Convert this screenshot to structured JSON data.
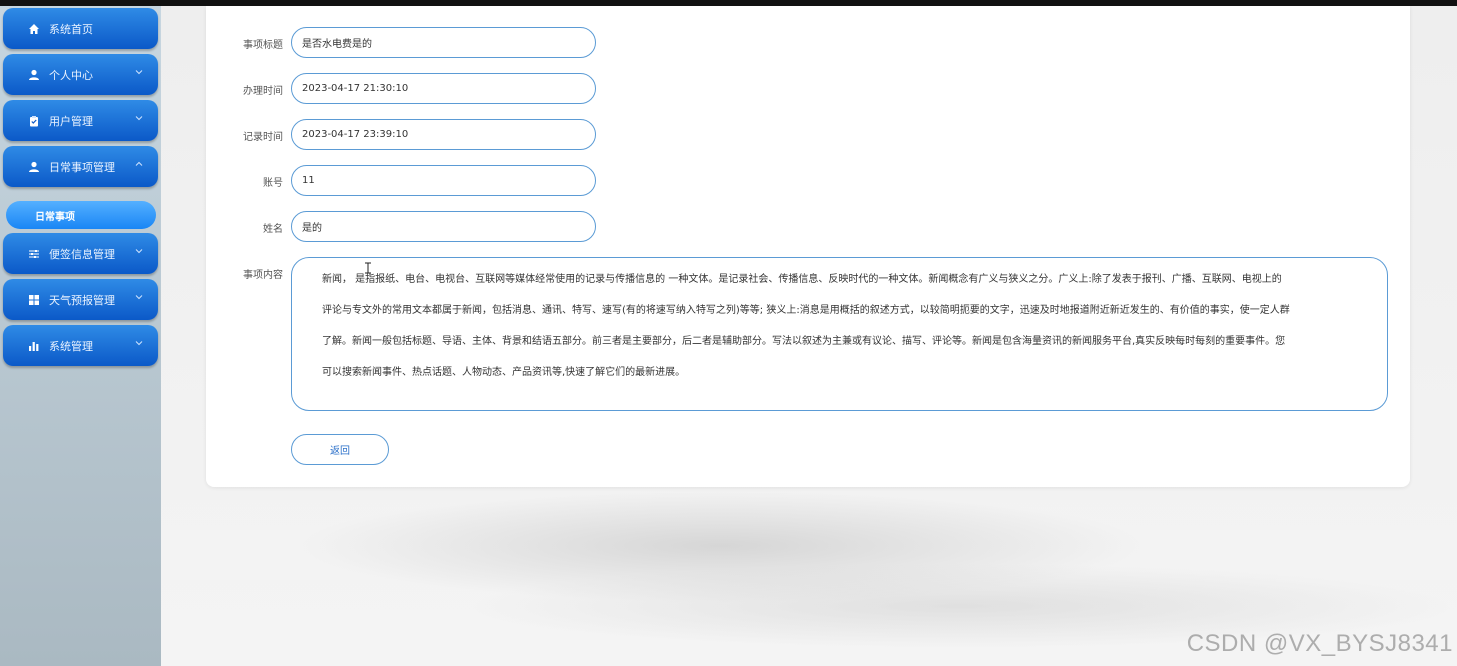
{
  "sidebar": {
    "items": [
      {
        "label": "系统首页",
        "icon": "home-icon",
        "expandable": false
      },
      {
        "label": "个人中心",
        "icon": "user-icon",
        "expandable": true
      },
      {
        "label": "用户管理",
        "icon": "clipboard-icon",
        "expandable": true
      },
      {
        "label": "日常事项管理",
        "icon": "user-icon",
        "expandable": true,
        "expanded": true
      },
      {
        "label": "便签信息管理",
        "icon": "sliders-icon",
        "expandable": true
      },
      {
        "label": "天气预报管理",
        "icon": "grid-icon",
        "expandable": true
      },
      {
        "label": "系统管理",
        "icon": "bar-chart-icon",
        "expandable": true
      }
    ],
    "active_sub_item": "日常事项"
  },
  "form": {
    "title_label": "事项标题",
    "title_value": "是否水电费是的",
    "handle_time_label": "办理时间",
    "handle_time_value": "2023-04-17 21:30:10",
    "record_time_label": "记录时间",
    "record_time_value": "2023-04-17 23:39:10",
    "account_label": "账号",
    "account_value": "11",
    "name_label": "姓名",
    "name_value": "是的",
    "content_label": "事项内容",
    "content_lines": [
      "新闻， 是指报纸、电台、电视台、互联网等媒体经常使用的记录与传播信息的 一种文体。是记录社会、传播信息、反映时代的一种文体。新闻概念有广义与狭义之分。广义上:除了发表于报刊、广播、互联网、电视上的",
      "评论与专文外的常用文本都属于新闻，包括消息、通讯、特写、速写(有的将速写纳入特写之列)等等; 狭义上:消息是用概括的叙述方式，以较简明扼要的文字，迅速及时地报道附近新近发生的、有价值的事实，使一定人群",
      "了解。新闻一般包括标题、导语、主体、背景和结语五部分。前三者是主要部分，后二者是辅助部分。写法以叙述为主兼或有议论、描写、评论等。新闻是包含海量资讯的新闻服务平台,真实反映每时每刻的重要事件。您",
      "可以搜索新闻事件、热点话题、人物动态、产品资讯等,快速了解它们的最新进展。"
    ],
    "back_label": "返回"
  },
  "watermark": "CSDN @VX_BYSJ8341",
  "colors": {
    "menu_blue": "#0b59c8",
    "submenu_blue": "#1a86f5",
    "field_border": "#5b9bd5"
  }
}
